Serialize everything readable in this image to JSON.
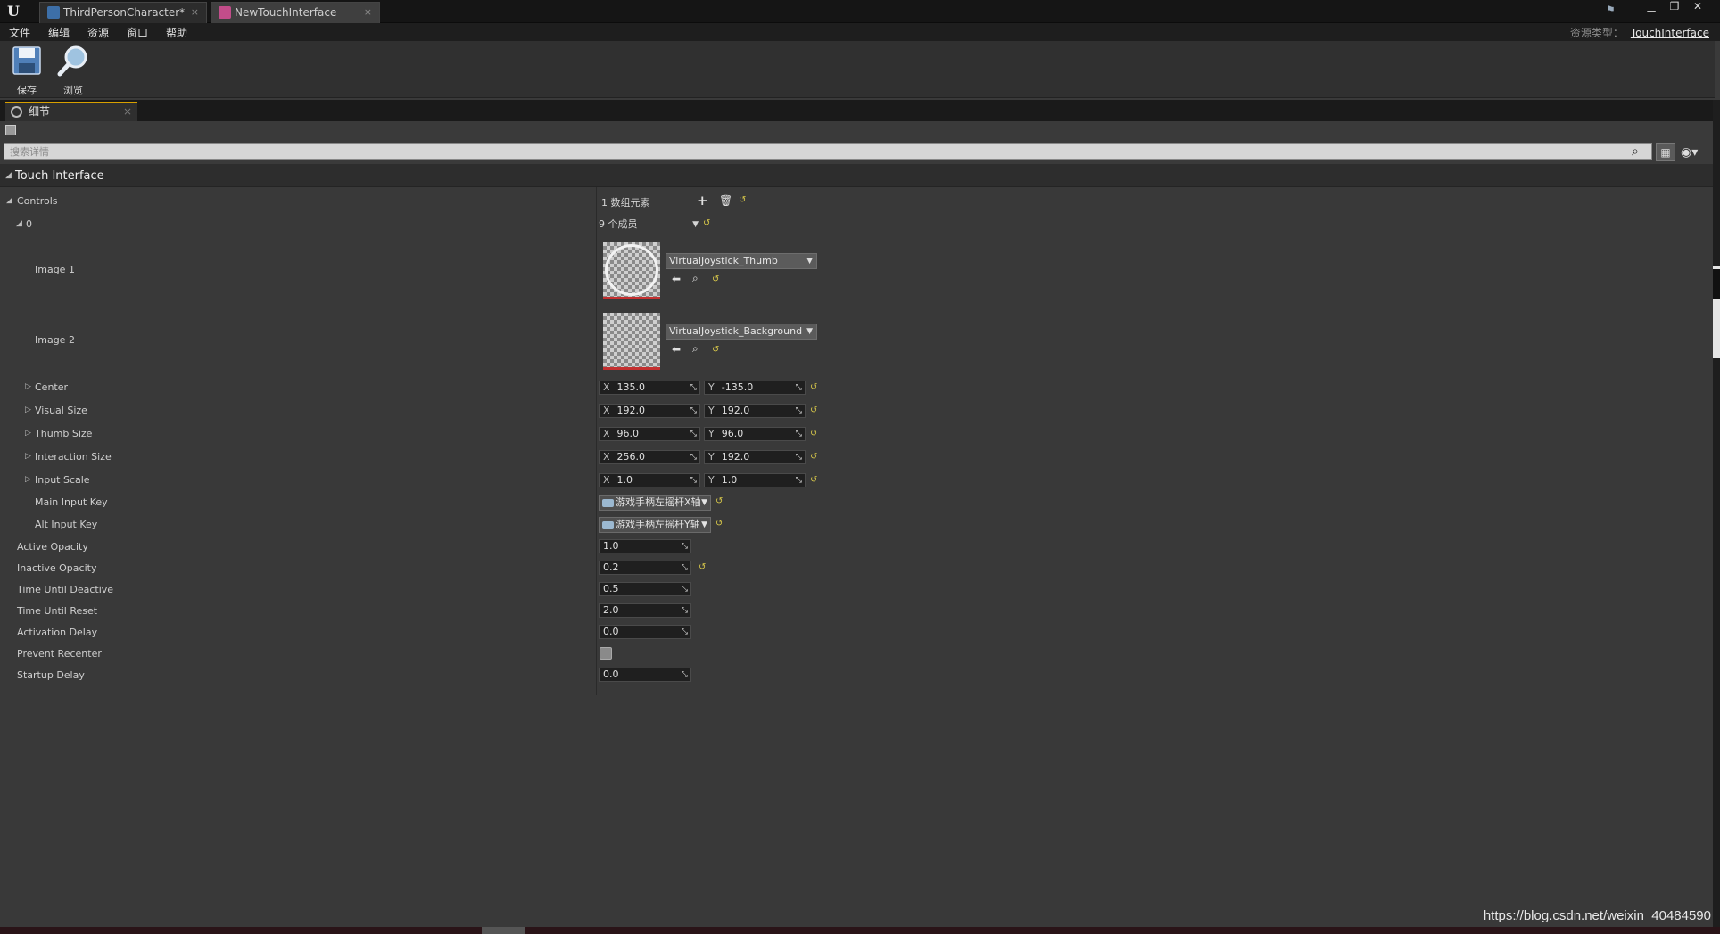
{
  "titlebar": {
    "tabs": [
      {
        "label": "ThirdPersonCharacter*"
      },
      {
        "label": "NewTouchInterface"
      }
    ]
  },
  "menu": {
    "items": [
      "文件",
      "编辑",
      "资源",
      "窗口",
      "帮助"
    ],
    "asset_type_label": "资源类型：",
    "asset_type_value": "TouchInterface"
  },
  "toolbar": {
    "save_label": "保存",
    "browse_label": "浏览"
  },
  "panel": {
    "tab_label": "细节"
  },
  "search": {
    "placeholder": "搜索详情"
  },
  "details": {
    "category": "Touch Interface",
    "controls_label": "Controls",
    "controls_count": "1 数组元素",
    "element_index": "0",
    "members_label": "9 个成员",
    "image1_label": "Image 1",
    "image1_asset": "VirtualJoystick_Thumb",
    "image2_label": "Image 2",
    "image2_asset": "VirtualJoystick_Background",
    "vectors": [
      {
        "label": "Center",
        "x": "135.0",
        "y": "-135.0"
      },
      {
        "label": "Visual Size",
        "x": "192.0",
        "y": "192.0"
      },
      {
        "label": "Thumb Size",
        "x": "96.0",
        "y": "96.0"
      },
      {
        "label": "Interaction Size",
        "x": "256.0",
        "y": "192.0"
      },
      {
        "label": "Input Scale",
        "x": "1.0",
        "y": "1.0"
      }
    ],
    "main_input_key_label": "Main Input Key",
    "main_input_key": "游戏手柄左摇杆X轴",
    "alt_input_key_label": "Alt Input Key",
    "alt_input_key": "游戏手柄左摇杆Y轴",
    "scalars": [
      {
        "label": "Active Opacity",
        "value": "1.0"
      },
      {
        "label": "Inactive Opacity",
        "value": "0.2"
      },
      {
        "label": "Time Until Deactive",
        "value": "0.5"
      },
      {
        "label": "Time Until Reset",
        "value": "2.0"
      },
      {
        "label": "Activation Delay",
        "value": "0.0"
      }
    ],
    "prevent_recenter_label": "Prevent Recenter",
    "prevent_recenter": false,
    "startup_delay_label": "Startup Delay",
    "startup_delay": "0.0",
    "axis_x": "X",
    "axis_y": "Y"
  },
  "watermark": "https://blog.csdn.net/weixin_40484590",
  "colors": {
    "reset_arrow": "#d8c84a",
    "accent_tab": "#d8a000",
    "thumb_underline": "#c43030"
  }
}
